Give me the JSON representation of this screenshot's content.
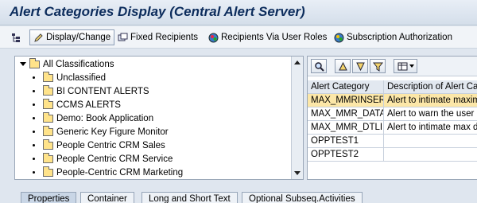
{
  "window": {
    "title": "Alert Categories Display (Central Alert Server)"
  },
  "toolbar": {
    "display_change_label": "Display/Change",
    "fixed_recipients_label": "Fixed Recipients",
    "recipients_via_user_roles_label": "Recipients Via User Roles",
    "subscription_authorization_label": "Subscription Authorization"
  },
  "tree": {
    "root_label": "All Classifications",
    "items": [
      {
        "label": "Unclassified"
      },
      {
        "label": "BI CONTENT ALERTS"
      },
      {
        "label": "CCMS ALERTS"
      },
      {
        "label": "Demo: Book Application"
      },
      {
        "label": "Generic Key Figure Monitor"
      },
      {
        "label": "People Centric CRM Sales"
      },
      {
        "label": "People Centric CRM Service"
      },
      {
        "label": "People-Centric CRM Marketing"
      }
    ]
  },
  "grid": {
    "columns": [
      "Alert Category",
      "Description of Alert Category"
    ],
    "rows": [
      {
        "category": "MAX_MMRINSERT",
        "description": "Alert to intimate maximum"
      },
      {
        "category": "MAX_MMR_DATA",
        "description": "Alert to warn the user"
      },
      {
        "category": "MAX_MMR_DTLIN",
        "description": "Alert to intimate max d"
      },
      {
        "category": "OPPTEST1",
        "description": ""
      },
      {
        "category": "OPPTEST2",
        "description": ""
      }
    ]
  },
  "tabs": [
    {
      "label": "Properties"
    },
    {
      "label": "Container"
    },
    {
      "label": "Long and Short Text"
    },
    {
      "label": "Optional Subseq.Activities"
    }
  ]
}
